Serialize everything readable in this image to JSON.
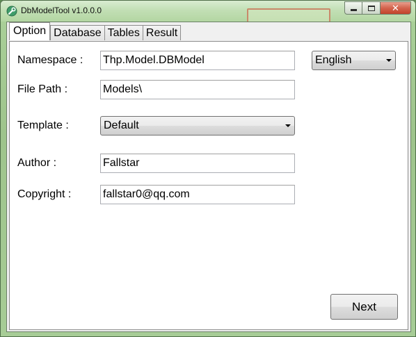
{
  "window": {
    "title": "DbModelTool v1.0.0.0",
    "close_glyph": "✕"
  },
  "tabs": [
    {
      "label": "Option",
      "active": true
    },
    {
      "label": "Database",
      "active": false
    },
    {
      "label": "Tables",
      "active": false
    },
    {
      "label": "Result",
      "active": false
    }
  ],
  "form": {
    "namespace_label": "Namespace :",
    "namespace_value": "Thp.Model.DBModel",
    "filepath_label": "File Path :",
    "filepath_value": "Models\\",
    "template_label": "Template :",
    "template_value": "Default",
    "author_label": "Author :",
    "author_value": "Fallstar",
    "copyright_label": "Copyright :",
    "copyright_value": "fallstar0@qq.com",
    "language_value": "English"
  },
  "buttons": {
    "next_label": "Next"
  },
  "icons": {
    "app": "wrench-gear-icon",
    "minimize": "minimize-icon",
    "maximize": "maximize-icon",
    "close": "close-icon"
  }
}
